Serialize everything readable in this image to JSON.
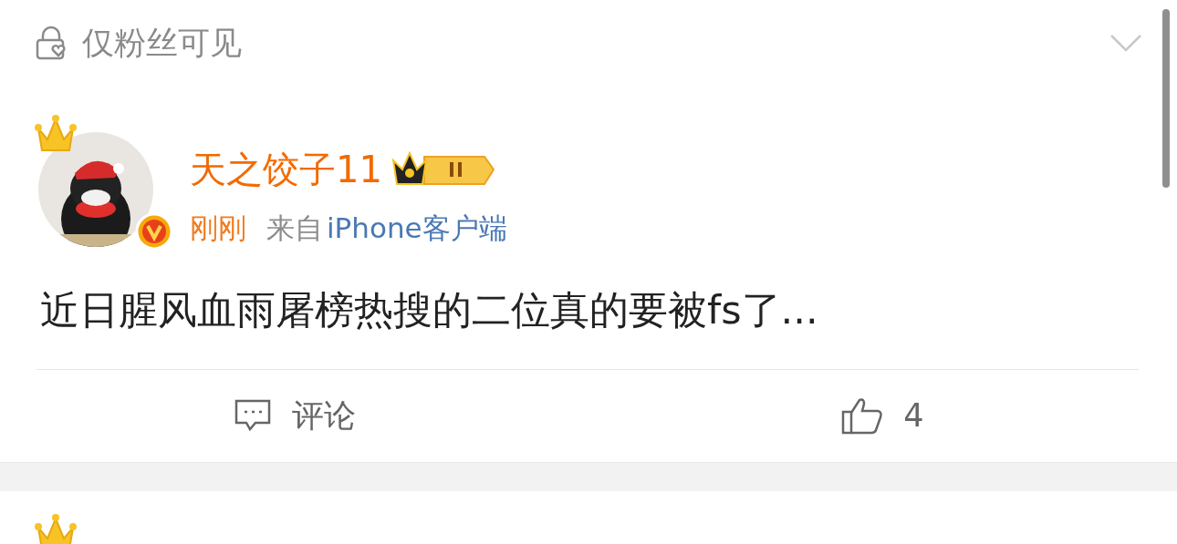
{
  "visibility": {
    "label": "仅粉丝可见"
  },
  "post": {
    "author": {
      "name": "天之饺子11",
      "verified": true
    },
    "time": "刚刚",
    "source_prefix": "来自",
    "source": "iPhone客户端",
    "text": "近日腥风血雨屠榜热搜的二位真的要被fs了...",
    "actions": [
      {
        "kind": "comment",
        "label": "评论"
      },
      {
        "kind": "like",
        "label": "4"
      }
    ]
  }
}
